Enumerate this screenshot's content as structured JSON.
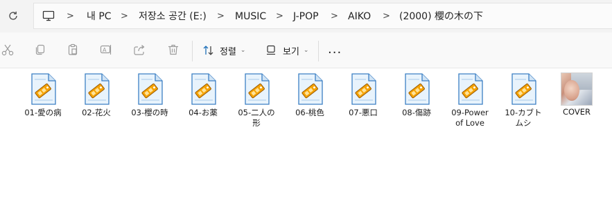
{
  "address_bar": {
    "breadcrumbs": [
      "내 PC",
      "저장소 공간 (E:)",
      "MUSIC",
      "J-POP",
      "AIKO",
      "(2000) 櫻の木の下"
    ]
  },
  "toolbar": {
    "icons": [
      "cut-icon",
      "copy-icon",
      "paste-icon",
      "rename-icon",
      "share-icon",
      "delete-icon"
    ],
    "sort_label": "정렬",
    "view_label": "보기",
    "more_label": "..."
  },
  "files": [
    {
      "name": "01-愛の病",
      "type": "audio"
    },
    {
      "name": "02-花火",
      "type": "audio"
    },
    {
      "name": "03-櫻の時",
      "type": "audio"
    },
    {
      "name": "04-お薬",
      "type": "audio"
    },
    {
      "name": "05-二人の形",
      "type": "audio"
    },
    {
      "name": "06-桃色",
      "type": "audio"
    },
    {
      "name": "07-悪口",
      "type": "audio"
    },
    {
      "name": "08-傷跡",
      "type": "audio"
    },
    {
      "name": "09-Power of Love",
      "type": "audio"
    },
    {
      "name": "10-カブトムシ",
      "type": "audio"
    },
    {
      "name": "COVER",
      "type": "image"
    }
  ],
  "colors": {
    "accent": "#f5a300",
    "file_icon": "#e8f3fc"
  }
}
